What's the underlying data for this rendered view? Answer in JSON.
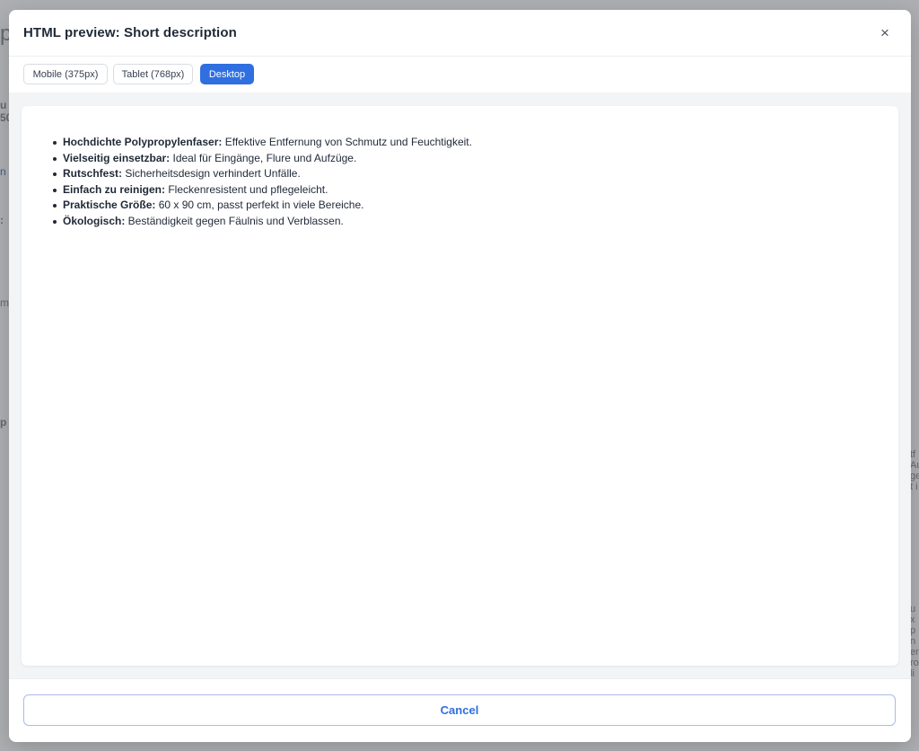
{
  "modal": {
    "title": "HTML preview: Short description",
    "close_label": "×"
  },
  "tabs": [
    {
      "label": "Mobile (375px)",
      "active": false
    },
    {
      "label": "Tablet (768px)",
      "active": false
    },
    {
      "label": "Desktop",
      "active": true
    }
  ],
  "preview": {
    "items": [
      {
        "bold": "Hochdichte Polypropylenfaser:",
        "text": " Effektive Entfernung von Schmutz und Feuchtigkeit."
      },
      {
        "bold": "Vielseitig einsetzbar:",
        "text": " Ideal für Eingänge, Flure und Aufzüge."
      },
      {
        "bold": "Rutschfest:",
        "text": " Sicherheitsdesign verhindert Unfälle."
      },
      {
        "bold": "Einfach zu reinigen:",
        "text": " Fleckenresistent und pflegeleicht."
      },
      {
        "bold": "Praktische Größe:",
        "text": " 60 x 90 cm, passt perfekt in viele Bereiche."
      },
      {
        "bold": "Ökologisch:",
        "text": " Beständigkeit gegen Fäulnis und Verblassen."
      }
    ]
  },
  "footer": {
    "cancel_label": "Cancel"
  },
  "colors": {
    "accent": "#2f6fe0",
    "overlay": "#5a5c62",
    "text": "#1f2937"
  }
}
